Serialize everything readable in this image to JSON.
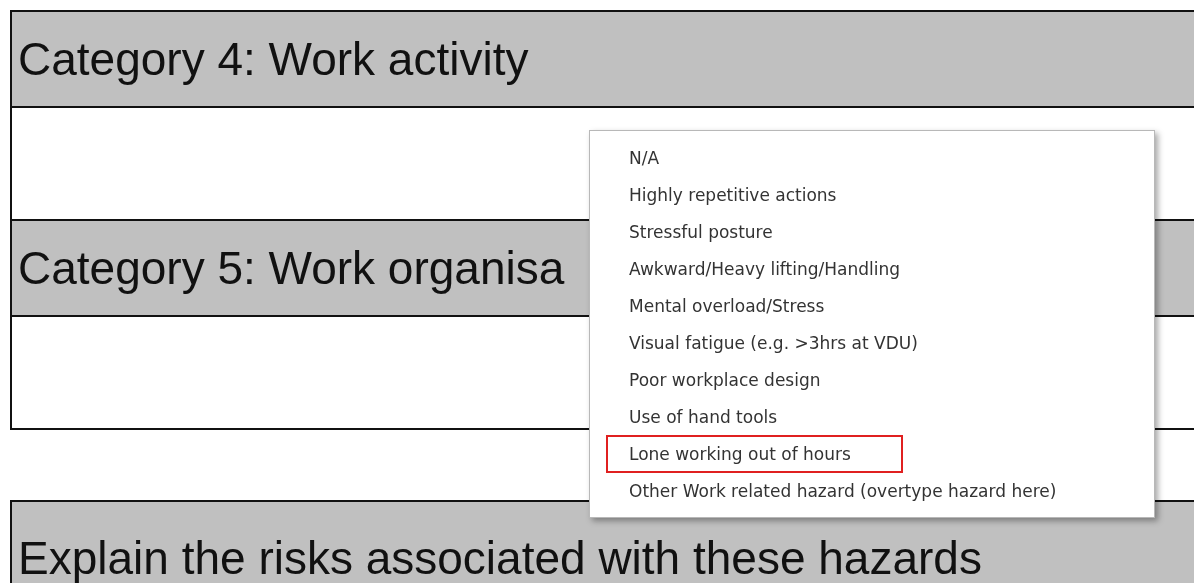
{
  "sections": [
    {
      "heading": "Category 4: Work activity"
    },
    {
      "heading": "Category 5: Work organisa"
    }
  ],
  "risks_heading": "Explain the risks associated with these hazards",
  "dropdown": {
    "items": [
      {
        "label": "N/A",
        "highlighted": false
      },
      {
        "label": "Highly repetitive actions",
        "highlighted": false
      },
      {
        "label": "Stressful posture",
        "highlighted": false
      },
      {
        "label": "Awkward/Heavy lifting/Handling",
        "highlighted": false
      },
      {
        "label": "Mental overload/Stress",
        "highlighted": false
      },
      {
        "label": "Visual fatigue (e.g. >3hrs at VDU)",
        "highlighted": false
      },
      {
        "label": "Poor workplace design",
        "highlighted": false
      },
      {
        "label": "Use of hand tools",
        "highlighted": false
      },
      {
        "label": "Lone working out of hours",
        "highlighted": true
      },
      {
        "label": "Other Work related hazard (overtype hazard here)",
        "highlighted": false
      }
    ]
  }
}
